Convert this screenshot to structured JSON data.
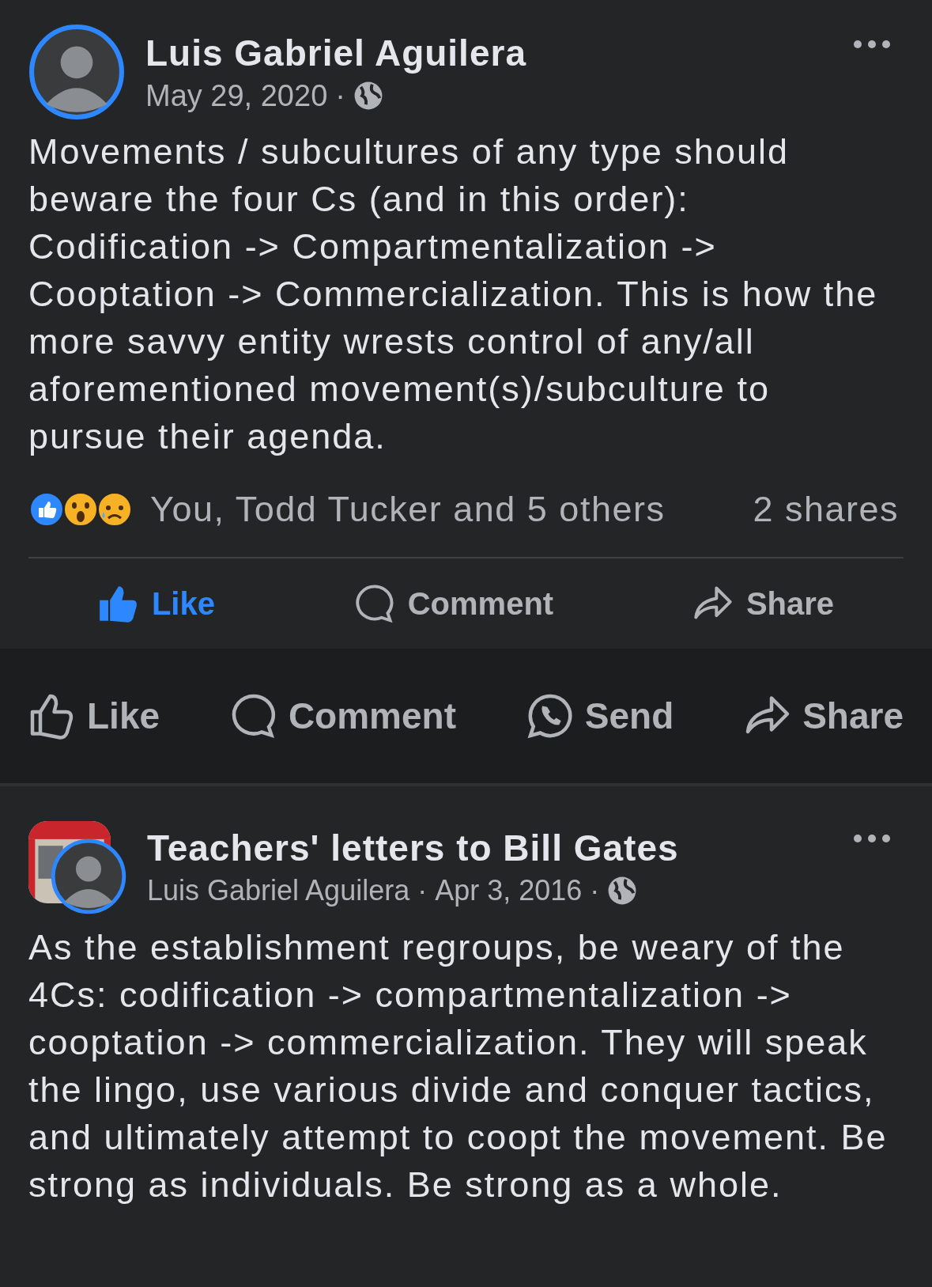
{
  "posts": [
    {
      "kind": "profile",
      "author": "Luis Gabriel Aguilera",
      "date": "May 29, 2020",
      "separator": "·",
      "body": "Movements / subcultures of any type should beware the four Cs (and in this order): Codification -> Compartmentalization -> Cooptation -> Commercialization. This is how the more savvy entity wrests control of any/all aforementioned movement(s)/subculture to pursue their agenda.",
      "reactions": {
        "summary": "You, Todd Tucker and 5 others",
        "shares": "2 shares"
      },
      "actions": [
        {
          "kind": "like",
          "label": "Like",
          "selected": true
        },
        {
          "kind": "comment",
          "label": "Comment",
          "selected": false
        },
        {
          "kind": "share",
          "label": "Share",
          "selected": false
        }
      ]
    }
  ],
  "action_bar": [
    {
      "kind": "like",
      "label": "Like",
      "selected": false
    },
    {
      "kind": "comment",
      "label": "Comment",
      "selected": false
    },
    {
      "kind": "send",
      "label": "Send",
      "selected": false
    },
    {
      "kind": "share",
      "label": "Share",
      "selected": false
    }
  ],
  "group_post": {
    "group": "Teachers' letters to Bill Gates",
    "author": "Luis Gabriel Aguilera",
    "separators": [
      "·",
      "·"
    ],
    "date": "Apr 3, 2016",
    "body": "As the establishment regroups, be weary of the 4Cs: codification -> compartmentalization -> cooptation -> commercialization. They will speak the lingo, use various divide and conquer tactics, and ultimately attempt to coopt the movement. Be strong as individuals. Be strong as a whole."
  }
}
